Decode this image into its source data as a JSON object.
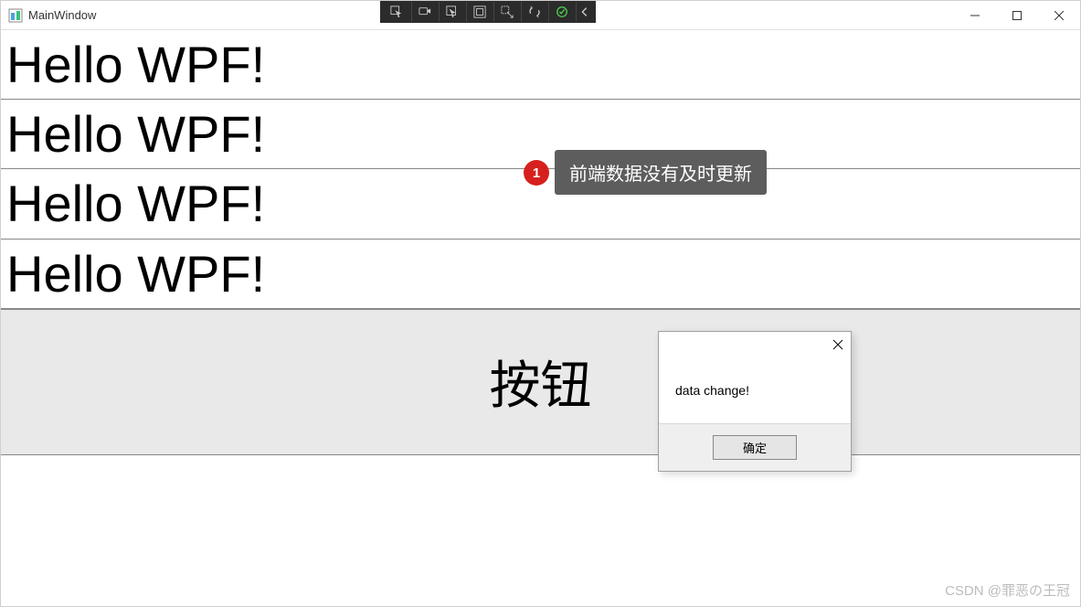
{
  "window": {
    "title": "MainWindow"
  },
  "rows": {
    "r1": "Hello WPF!",
    "r2": "Hello WPF!",
    "r3": "Hello WPF!",
    "r4": "Hello WPF!"
  },
  "button": {
    "label": "按钮"
  },
  "callout": {
    "number": "1",
    "text": "前端数据没有及时更新"
  },
  "msgbox": {
    "body": "data change!",
    "ok_label": "确定"
  },
  "watermark": "CSDN @罪恶の王冠"
}
